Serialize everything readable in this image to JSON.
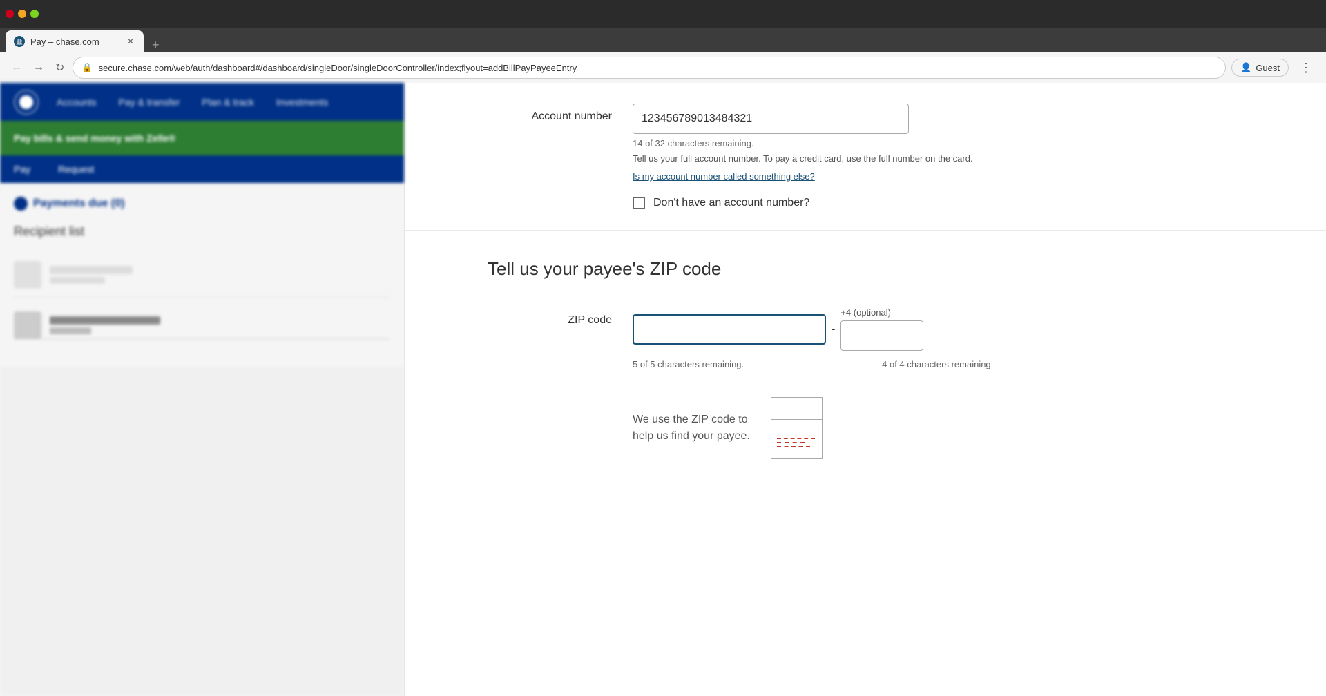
{
  "browser": {
    "tab_title": "Pay – chase.com",
    "url": "secure.chase.com/web/auth/dashboard#/dashboard/singleDoor/singleDoorController/index;flyout=addBillPayPayeeEntry",
    "user_label": "Guest"
  },
  "left_panel": {
    "nav_items": [
      "Accounts",
      "Pay & transfer",
      "Plan & track",
      "Investments"
    ],
    "green_banner_text": "Pay bills & send money with Zelle®",
    "pay_tab": "Pay",
    "request_tab": "Request",
    "payments_title": "Payments due (0)",
    "recipient_title": "Recipient list"
  },
  "account_section": {
    "label": "Account number",
    "value": "123456789013484321",
    "chars_remaining": "14 of 32 characters remaining.",
    "helper_text": "Tell us your full account number. To pay a credit card, use the full number on the card.",
    "link_text": "Is my account number called something else?",
    "checkbox_label": "Don't have an account number?"
  },
  "zip_section": {
    "title": "Tell us your payee's ZIP code",
    "label": "ZIP code",
    "zip_value": "",
    "zip_chars_remaining": "5 of 5 characters remaining.",
    "optional_label": "+4 (optional)",
    "optional_chars_remaining": "4 of 4 characters remaining.",
    "info_text": "We use the ZIP code to\nhelp us find your payee."
  }
}
